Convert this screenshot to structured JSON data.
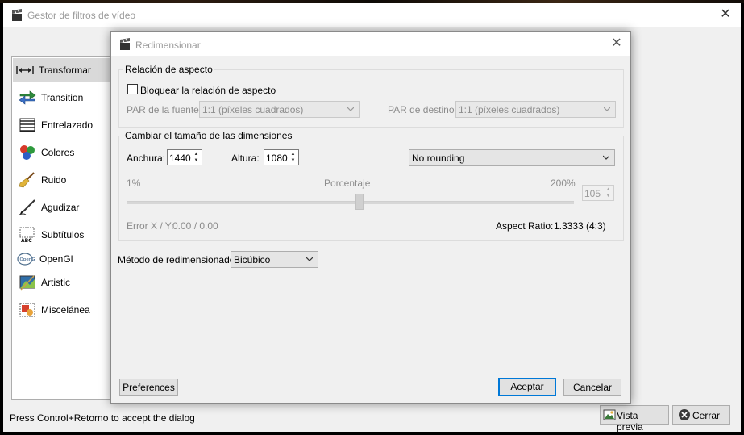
{
  "main_window": {
    "title": "Gestor de filtros de vídeo",
    "categories": [
      {
        "label": "Transformar",
        "icon": "resize-arrows-icon",
        "selected": true
      },
      {
        "label": "Transition",
        "icon": "swap-arrows-icon"
      },
      {
        "label": "Entrelazado",
        "icon": "interlace-lines-icon"
      },
      {
        "label": "Colores",
        "icon": "color-balls-icon"
      },
      {
        "label": "Ruido",
        "icon": "broom-icon"
      },
      {
        "label": "Agudizar",
        "icon": "pen-nib-icon"
      },
      {
        "label": "Subtítulos",
        "icon": "subtitles-abc-icon"
      },
      {
        "label": "OpenGl",
        "icon": "opengl-icon"
      },
      {
        "label": "Artistic",
        "icon": "paint-canvas-icon"
      },
      {
        "label": "Miscelánea",
        "icon": "shapes-icon"
      }
    ],
    "status_text": "Press Control+Retorno to accept the dialog",
    "preview_button": "Vista previa",
    "close_button": "Cerrar"
  },
  "dialog": {
    "title": "Redimensionar",
    "aspect_group": {
      "title": "Relación de aspecto",
      "lock_label": "Bloquear la relación de aspecto",
      "lock_checked": false,
      "source_par_label": "PAR de la fuente:",
      "source_par_value": "1:1 (píxeles cuadrados)",
      "dest_par_label": "PAR de destino:",
      "dest_par_value": "1:1 (píxeles cuadrados)"
    },
    "resize_group": {
      "title": "Cambiar el tamaño de las dimensiones",
      "width_label": "Anchura:",
      "width_value": "1440",
      "height_label": "Altura:",
      "height_value": "1080",
      "rounding_value": "No rounding",
      "min_percent": "1%",
      "percent_label": "Porcentaje",
      "max_percent": "200%",
      "percent_value": "105",
      "slider_fraction": 0.52,
      "error_label": "Error X / Y:",
      "error_value": "0.00 / 0.00",
      "aspect_label": "Aspect Ratio:",
      "aspect_value": "1.3333",
      "aspect_ratio_text": "(4:3)"
    },
    "method_label": "Método de redimensionado:",
    "method_value": "Bicúbico",
    "preferences_button": "Preferences",
    "accept_button": "Aceptar",
    "cancel_button": "Cancelar"
  }
}
